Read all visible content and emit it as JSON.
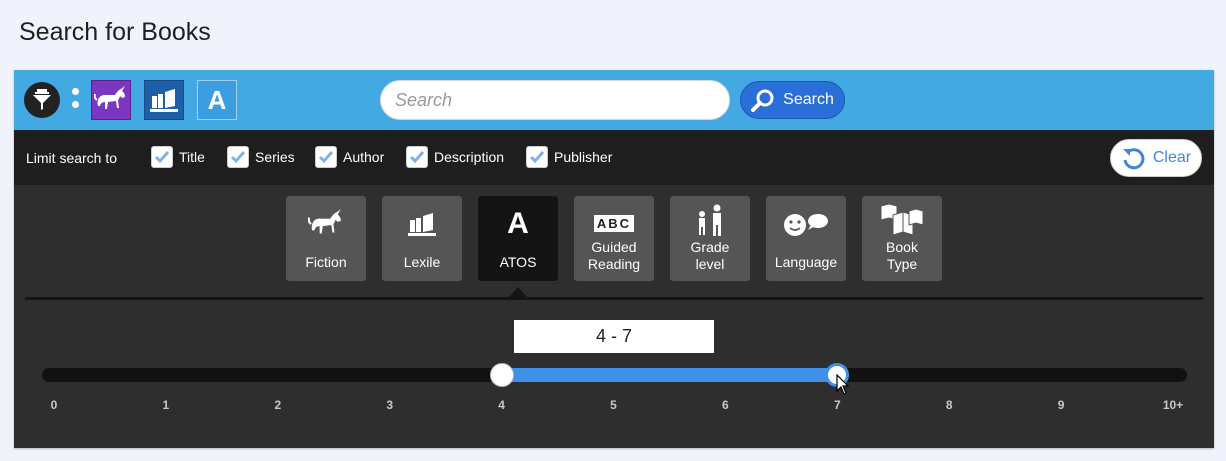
{
  "page_title": "Search for Books",
  "toolbar": {
    "search_placeholder": "Search",
    "search_value": "",
    "search_button": "Search",
    "icons": [
      "filter-icon",
      "unicorn-icon",
      "books-icon",
      "atos-letter-icon"
    ],
    "atos_chip_letter": "A"
  },
  "limit": {
    "label": "Limit search to",
    "options": [
      {
        "label": "Title",
        "checked": true
      },
      {
        "label": "Series",
        "checked": true
      },
      {
        "label": "Author",
        "checked": true
      },
      {
        "label": "Description",
        "checked": true
      },
      {
        "label": "Publisher",
        "checked": true
      }
    ],
    "clear_button": "Clear"
  },
  "tabs": [
    {
      "label": "Fiction",
      "icon": "unicorn-icon",
      "active": false
    },
    {
      "label": "Lexile",
      "icon": "books-icon",
      "active": false
    },
    {
      "label": "ATOS",
      "icon": "atos-letter-icon",
      "icon_text": "A",
      "active": true
    },
    {
      "label": "Guided Reading",
      "line1": "Guided",
      "line2": "Reading",
      "icon": "abc-blocks-icon",
      "icon_text": "ABC",
      "active": false
    },
    {
      "label": "Grade level",
      "line1": "Grade",
      "line2": "level",
      "icon": "child-adult-icon",
      "active": false
    },
    {
      "label": "Language",
      "icon": "speech-face-icon",
      "active": false
    },
    {
      "label": "Book Type",
      "line1": "Book",
      "line2": "Type",
      "icon": "open-books-icon",
      "active": false
    }
  ],
  "slider": {
    "range_text": "4 - 7",
    "min_value": 4,
    "max_value": 7,
    "ticks": [
      "0",
      "1",
      "2",
      "3",
      "4",
      "5",
      "6",
      "7",
      "8",
      "9",
      "10+"
    ],
    "colors": {
      "fill": "#3f90e8",
      "track": "#111111"
    }
  },
  "colors": {
    "topbar": "#42a9e3",
    "search_button": "#2a6fd8",
    "fiction_chip": "#7b36c2",
    "lexile_chip": "#1f5fa8"
  }
}
